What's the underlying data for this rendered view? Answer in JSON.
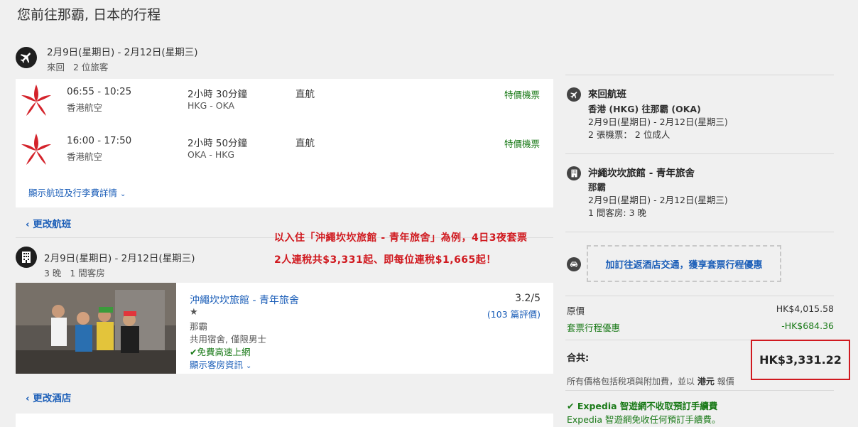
{
  "page_title": "您前往那霸, 日本的行程",
  "flight_section": {
    "dates": "2月9日(星期日) - 2月12日(星期三)",
    "trip_type": "來回",
    "travelers": "2 位旅客",
    "flights": [
      {
        "time": "06:55 - 10:25",
        "airline": "香港航空",
        "duration": "2小時 30分鐘",
        "route": "HKG - OKA",
        "stops": "直航",
        "deal": "特價機票"
      },
      {
        "time": "16:00 - 17:50",
        "airline": "香港航空",
        "duration": "2小時 50分鐘",
        "route": "OKA - HKG",
        "stops": "直航",
        "deal": "特價機票"
      }
    ],
    "details_link": "顯示航班及行李費詳情",
    "change_label": "更改航班"
  },
  "promo": {
    "line1": "以入住「沖繩坎坎旅館 - 青年旅舍」為例，4日3夜套票",
    "line2": "2人連稅共$3,331起、即每位連稅$1,665起！"
  },
  "hotel_section": {
    "dates": "2月9日(星期日) - 2月12日(星期三)",
    "nights": "3 晚",
    "rooms": "1 間客房",
    "name": "沖繩坎坎旅館 - 青年旅舍",
    "stars": "★",
    "city": "那霸",
    "room_type": "共用宿舍, 僅限男士",
    "wifi": "免費高速上網",
    "room_info_link": "顯示客房資訊",
    "rating": "3.2/5",
    "reviews": "(103 篇評價)",
    "change_label": "更改酒店"
  },
  "sidebar": {
    "flight": {
      "title": "來回航班",
      "route": "香港 (HKG) 往那霸 (OKA)",
      "dates": "2月9日(星期日) - 2月12日(星期三)",
      "tickets": "2 張機票： 2 位成人"
    },
    "hotel": {
      "title": "沖繩坎坎旅館 - 青年旅舍",
      "city": "那霸",
      "dates": "2月9日(星期日) - 2月12日(星期三)",
      "rooms": "1 間客房: 3 晚"
    },
    "transfer_cta": "加訂往返酒店交通，獲享套票行程優惠",
    "original_label": "原價",
    "original_price": "HK$4,015.58",
    "discount_label": "套票行程優惠",
    "discount_value": "-HK$684.36",
    "total_label": "合共:",
    "total_value": "HK$3,331.22",
    "tax_note": "所有價格包括稅項與附加費，並以",
    "currency": "港元",
    "tax_note_end": "報價",
    "fee_title": "Expedia 智遊網不收取預訂手續費",
    "fee_note": "Expedia 智遊網免收任何預訂手續費。"
  },
  "colors": {
    "link": "#1b5eb8",
    "deal": "#1a7a18",
    "promo": "#d0191f",
    "airline_logo": "#d4222a"
  }
}
